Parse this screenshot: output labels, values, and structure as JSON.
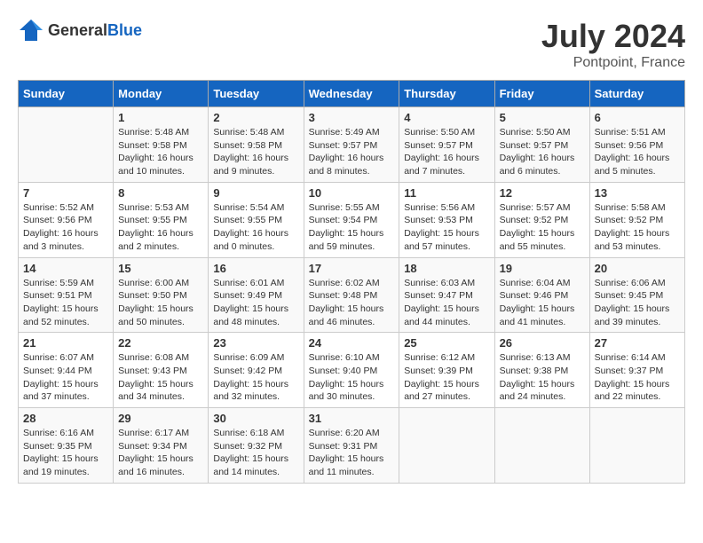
{
  "logo": {
    "general": "General",
    "blue": "Blue"
  },
  "title": {
    "month_year": "July 2024",
    "location": "Pontpoint, France"
  },
  "calendar": {
    "headers": [
      "Sunday",
      "Monday",
      "Tuesday",
      "Wednesday",
      "Thursday",
      "Friday",
      "Saturday"
    ],
    "weeks": [
      [
        {
          "num": "",
          "sunrise": "",
          "sunset": "",
          "daylight": ""
        },
        {
          "num": "1",
          "sunrise": "Sunrise: 5:48 AM",
          "sunset": "Sunset: 9:58 PM",
          "daylight": "Daylight: 16 hours and 10 minutes."
        },
        {
          "num": "2",
          "sunrise": "Sunrise: 5:48 AM",
          "sunset": "Sunset: 9:58 PM",
          "daylight": "Daylight: 16 hours and 9 minutes."
        },
        {
          "num": "3",
          "sunrise": "Sunrise: 5:49 AM",
          "sunset": "Sunset: 9:57 PM",
          "daylight": "Daylight: 16 hours and 8 minutes."
        },
        {
          "num": "4",
          "sunrise": "Sunrise: 5:50 AM",
          "sunset": "Sunset: 9:57 PM",
          "daylight": "Daylight: 16 hours and 7 minutes."
        },
        {
          "num": "5",
          "sunrise": "Sunrise: 5:50 AM",
          "sunset": "Sunset: 9:57 PM",
          "daylight": "Daylight: 16 hours and 6 minutes."
        },
        {
          "num": "6",
          "sunrise": "Sunrise: 5:51 AM",
          "sunset": "Sunset: 9:56 PM",
          "daylight": "Daylight: 16 hours and 5 minutes."
        }
      ],
      [
        {
          "num": "7",
          "sunrise": "Sunrise: 5:52 AM",
          "sunset": "Sunset: 9:56 PM",
          "daylight": "Daylight: 16 hours and 3 minutes."
        },
        {
          "num": "8",
          "sunrise": "Sunrise: 5:53 AM",
          "sunset": "Sunset: 9:55 PM",
          "daylight": "Daylight: 16 hours and 2 minutes."
        },
        {
          "num": "9",
          "sunrise": "Sunrise: 5:54 AM",
          "sunset": "Sunset: 9:55 PM",
          "daylight": "Daylight: 16 hours and 0 minutes."
        },
        {
          "num": "10",
          "sunrise": "Sunrise: 5:55 AM",
          "sunset": "Sunset: 9:54 PM",
          "daylight": "Daylight: 15 hours and 59 minutes."
        },
        {
          "num": "11",
          "sunrise": "Sunrise: 5:56 AM",
          "sunset": "Sunset: 9:53 PM",
          "daylight": "Daylight: 15 hours and 57 minutes."
        },
        {
          "num": "12",
          "sunrise": "Sunrise: 5:57 AM",
          "sunset": "Sunset: 9:52 PM",
          "daylight": "Daylight: 15 hours and 55 minutes."
        },
        {
          "num": "13",
          "sunrise": "Sunrise: 5:58 AM",
          "sunset": "Sunset: 9:52 PM",
          "daylight": "Daylight: 15 hours and 53 minutes."
        }
      ],
      [
        {
          "num": "14",
          "sunrise": "Sunrise: 5:59 AM",
          "sunset": "Sunset: 9:51 PM",
          "daylight": "Daylight: 15 hours and 52 minutes."
        },
        {
          "num": "15",
          "sunrise": "Sunrise: 6:00 AM",
          "sunset": "Sunset: 9:50 PM",
          "daylight": "Daylight: 15 hours and 50 minutes."
        },
        {
          "num": "16",
          "sunrise": "Sunrise: 6:01 AM",
          "sunset": "Sunset: 9:49 PM",
          "daylight": "Daylight: 15 hours and 48 minutes."
        },
        {
          "num": "17",
          "sunrise": "Sunrise: 6:02 AM",
          "sunset": "Sunset: 9:48 PM",
          "daylight": "Daylight: 15 hours and 46 minutes."
        },
        {
          "num": "18",
          "sunrise": "Sunrise: 6:03 AM",
          "sunset": "Sunset: 9:47 PM",
          "daylight": "Daylight: 15 hours and 44 minutes."
        },
        {
          "num": "19",
          "sunrise": "Sunrise: 6:04 AM",
          "sunset": "Sunset: 9:46 PM",
          "daylight": "Daylight: 15 hours and 41 minutes."
        },
        {
          "num": "20",
          "sunrise": "Sunrise: 6:06 AM",
          "sunset": "Sunset: 9:45 PM",
          "daylight": "Daylight: 15 hours and 39 minutes."
        }
      ],
      [
        {
          "num": "21",
          "sunrise": "Sunrise: 6:07 AM",
          "sunset": "Sunset: 9:44 PM",
          "daylight": "Daylight: 15 hours and 37 minutes."
        },
        {
          "num": "22",
          "sunrise": "Sunrise: 6:08 AM",
          "sunset": "Sunset: 9:43 PM",
          "daylight": "Daylight: 15 hours and 34 minutes."
        },
        {
          "num": "23",
          "sunrise": "Sunrise: 6:09 AM",
          "sunset": "Sunset: 9:42 PM",
          "daylight": "Daylight: 15 hours and 32 minutes."
        },
        {
          "num": "24",
          "sunrise": "Sunrise: 6:10 AM",
          "sunset": "Sunset: 9:40 PM",
          "daylight": "Daylight: 15 hours and 30 minutes."
        },
        {
          "num": "25",
          "sunrise": "Sunrise: 6:12 AM",
          "sunset": "Sunset: 9:39 PM",
          "daylight": "Daylight: 15 hours and 27 minutes."
        },
        {
          "num": "26",
          "sunrise": "Sunrise: 6:13 AM",
          "sunset": "Sunset: 9:38 PM",
          "daylight": "Daylight: 15 hours and 24 minutes."
        },
        {
          "num": "27",
          "sunrise": "Sunrise: 6:14 AM",
          "sunset": "Sunset: 9:37 PM",
          "daylight": "Daylight: 15 hours and 22 minutes."
        }
      ],
      [
        {
          "num": "28",
          "sunrise": "Sunrise: 6:16 AM",
          "sunset": "Sunset: 9:35 PM",
          "daylight": "Daylight: 15 hours and 19 minutes."
        },
        {
          "num": "29",
          "sunrise": "Sunrise: 6:17 AM",
          "sunset": "Sunset: 9:34 PM",
          "daylight": "Daylight: 15 hours and 16 minutes."
        },
        {
          "num": "30",
          "sunrise": "Sunrise: 6:18 AM",
          "sunset": "Sunset: 9:32 PM",
          "daylight": "Daylight: 15 hours and 14 minutes."
        },
        {
          "num": "31",
          "sunrise": "Sunrise: 6:20 AM",
          "sunset": "Sunset: 9:31 PM",
          "daylight": "Daylight: 15 hours and 11 minutes."
        },
        {
          "num": "",
          "sunrise": "",
          "sunset": "",
          "daylight": ""
        },
        {
          "num": "",
          "sunrise": "",
          "sunset": "",
          "daylight": ""
        },
        {
          "num": "",
          "sunrise": "",
          "sunset": "",
          "daylight": ""
        }
      ]
    ]
  }
}
